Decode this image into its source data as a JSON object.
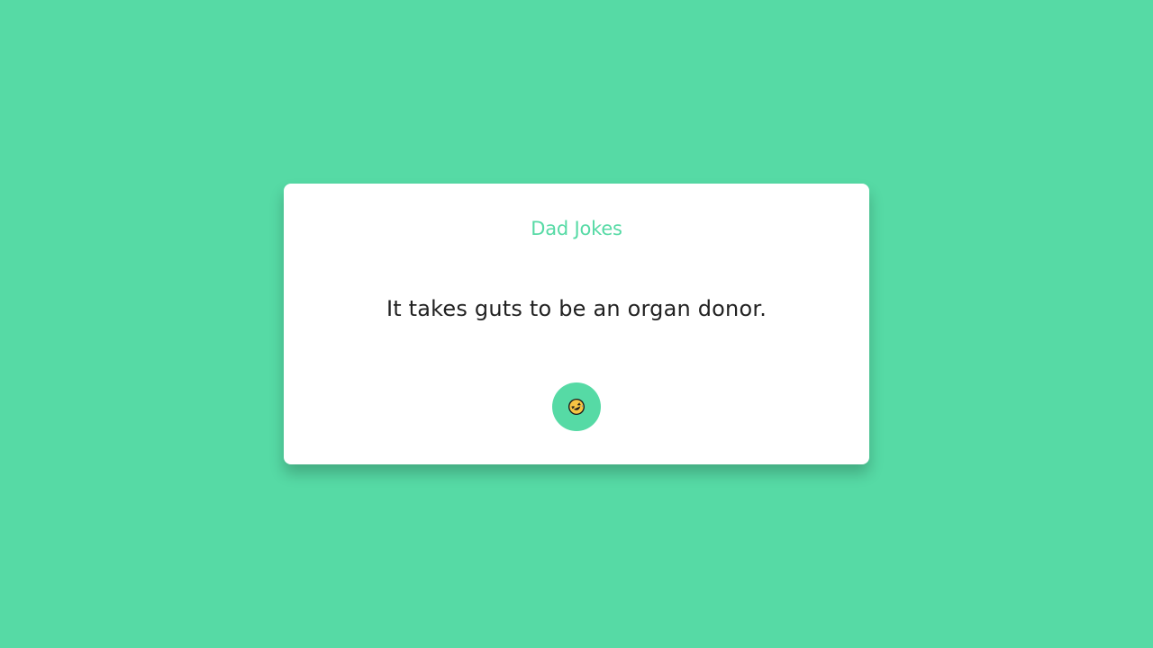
{
  "app": {
    "title": "Dad Jokes",
    "joke": "It takes guts to be an organ donor.",
    "colors": {
      "background": "#56daa5",
      "card": "#ffffff",
      "accent": "#56daa5",
      "text": "#222222"
    }
  },
  "button": {
    "icon": "rolling-on-floor-laughing-icon",
    "aria_label": "Get new joke"
  }
}
